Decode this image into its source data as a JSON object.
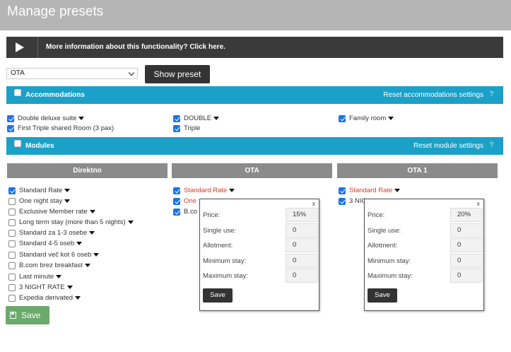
{
  "page": {
    "title": "Manage presets"
  },
  "info": {
    "text": "More information about this functionality? Click here."
  },
  "preset": {
    "selected": "OTA",
    "show_label": "Show preset"
  },
  "accommodations": {
    "label": "Accommodations",
    "reset": "Reset accommodations settings",
    "help": "?",
    "items": [
      {
        "label": "Double deluxe suite",
        "checked": true
      },
      {
        "label": "DOUBLE",
        "checked": true
      },
      {
        "label": "Family room",
        "checked": true
      },
      {
        "label": "First Triple shared Room (3 pax)",
        "checked": true
      },
      {
        "label": "Triple",
        "checked": true
      }
    ]
  },
  "modules": {
    "label": "Modules",
    "reset": "Reset module settings",
    "help": "?"
  },
  "columns": [
    {
      "name": "Direktno",
      "items": [
        {
          "label": "Standard Rate",
          "checked": true
        },
        {
          "label": "One night stay",
          "checked": false
        },
        {
          "label": "Exclusive Member rate",
          "checked": false
        },
        {
          "label": "Long term stay (more than 5 nights)",
          "checked": false
        },
        {
          "label": "Standard za 1-3 osebe",
          "checked": false
        },
        {
          "label": "Standard 4-5 oseb",
          "checked": false
        },
        {
          "label": "Standard več kot 6 oseb",
          "checked": false
        },
        {
          "label": "B.com brez breakfast",
          "checked": false
        },
        {
          "label": "Last minute",
          "checked": false
        },
        {
          "label": "3 NIGHT RATE",
          "checked": false
        },
        {
          "label": "Expedia derivated",
          "checked": false
        }
      ]
    },
    {
      "name": "OTA",
      "items": [
        {
          "label": "Standard Rate",
          "checked": true
        },
        {
          "label": "One",
          "checked": true
        },
        {
          "label": "B.co",
          "checked": true
        }
      ]
    },
    {
      "name": "OTA 1",
      "items": [
        {
          "label": "Standard Rate",
          "checked": true
        },
        {
          "label": "3 NIG",
          "checked": true
        }
      ]
    }
  ],
  "popups": [
    {
      "close": "x",
      "fields": [
        {
          "label": "Price:",
          "value": "15%"
        },
        {
          "label": "Single use:",
          "value": "0"
        },
        {
          "label": "Allotment:",
          "value": "0"
        },
        {
          "label": "Minimum stay:",
          "value": "0"
        },
        {
          "label": "Maximum stay:",
          "value": "0"
        }
      ],
      "save": "Save"
    },
    {
      "close": "x",
      "fields": [
        {
          "label": "Price:",
          "value": "20%"
        },
        {
          "label": "Single use:",
          "value": "0"
        },
        {
          "label": "Allotment:",
          "value": "0"
        },
        {
          "label": "Minimum stay:",
          "value": "0"
        },
        {
          "label": "Maximum stay:",
          "value": "0"
        }
      ],
      "save": "Save"
    }
  ],
  "footer": {
    "save_label": "Save"
  },
  "colors": {
    "accent": "#1ba0c8",
    "header": "#b5b5b5",
    "save": "#6ca96c",
    "warning_text": "#d43b2a"
  }
}
